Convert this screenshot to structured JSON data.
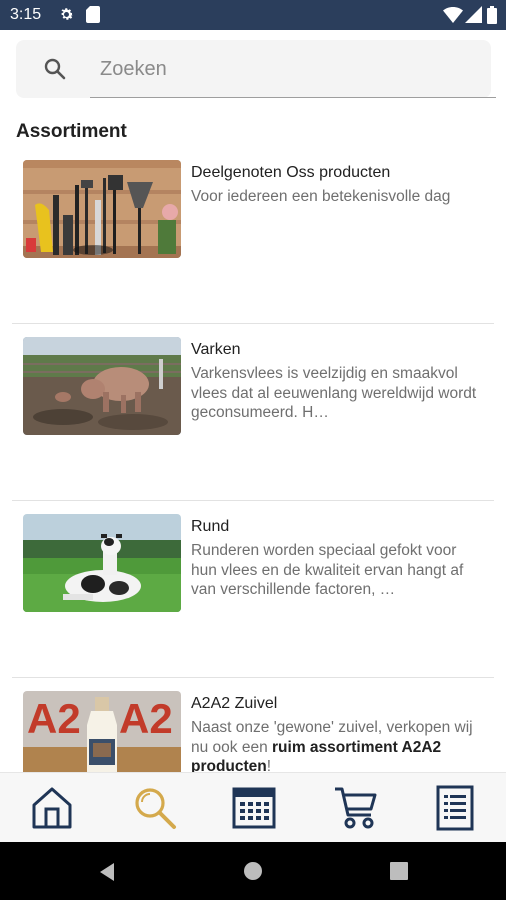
{
  "status_bar": {
    "time": "3:15",
    "left_icons": [
      "settings-icon",
      "sd-card-icon"
    ],
    "right_icons": [
      "wifi-icon",
      "signal-icon",
      "battery-icon"
    ]
  },
  "search": {
    "placeholder": "Zoeken",
    "value": ""
  },
  "section_title": "Assortiment",
  "items": [
    {
      "title": "Deelgenoten Oss producten",
      "description": "Voor iedereen een betekenisvolle dag",
      "image": "garden-tools-photo"
    },
    {
      "title": "Varken",
      "description": "Varkensvlees is veelzijdig en smaakvol vlees dat al eeuwenlang wereldwijd wordt geconsumeerd. H…",
      "image": "pig-photo"
    },
    {
      "title": "Rund",
      "description": "Runderen worden speciaal gefokt voor hun vlees en de kwaliteit ervan hangt af van verschillende factoren, …",
      "image": "cow-photo"
    },
    {
      "title": "A2A2 Zuivel",
      "description_part1": "Naast onze 'gewone' zuivel, verkopen wij nu ook een ",
      "description_bold1": "ruim assortiment A2A2 producten",
      "description_part2": "!",
      "image": "milk-bottle-photo",
      "image_text_left": "A2",
      "image_text_right": "A2"
    }
  ],
  "bottom_nav": {
    "items": [
      "home-icon",
      "search-icon",
      "calendar-icon",
      "cart-icon",
      "list-icon"
    ],
    "active": "search-icon",
    "active_color": "#d4a94c",
    "icon_color": "#1f3556"
  },
  "colors": {
    "status_bar": "#2b3e5c",
    "system_nav": "#000000"
  }
}
